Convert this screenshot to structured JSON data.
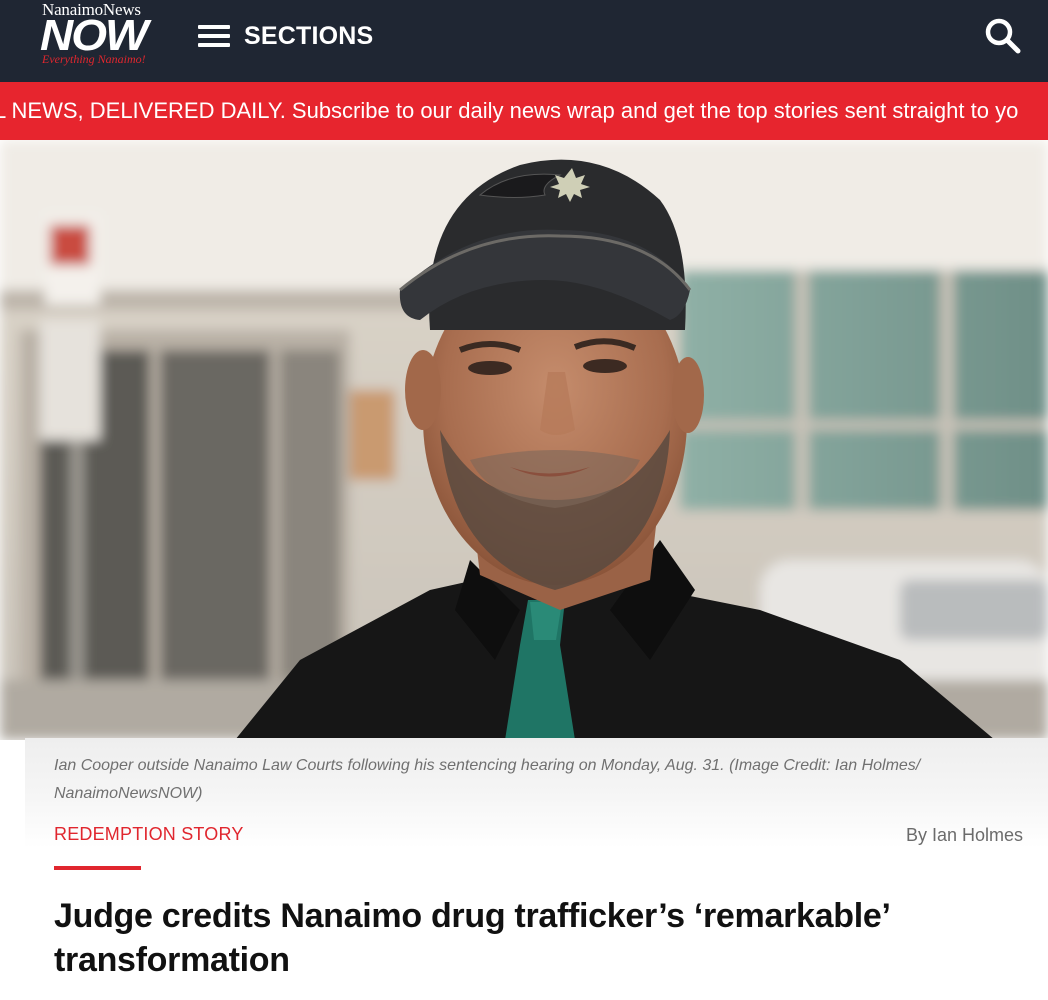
{
  "header": {
    "logo_top": "NanaimoNews",
    "logo_main": "NOW",
    "logo_tagline": "Everything Nanaimo!",
    "sections_label": "SECTIONS",
    "search_icon": "search-icon",
    "menu_icon": "hamburger-icon"
  },
  "ticker": {
    "text": "L NEWS, DELIVERED DAILY. Subscribe to our daily news wrap and get the top stories sent straight to yo"
  },
  "hero": {
    "image": "photo-man-in-cap-outside-courthouse"
  },
  "article": {
    "caption": "Ian Cooper outside Nanaimo Law Courts following his sentencing hearing on Monday, Aug. 31. (Image Credit: Ian Holmes/ NanaimoNewsNOW)",
    "category": "REDEMPTION STORY",
    "byline": "By Ian Holmes",
    "headline": "Judge credits Nanaimo drug trafficker’s ‘remarkable’ transformation"
  },
  "colors": {
    "header_bg": "#1f2633",
    "accent_red": "#e7252e",
    "headline_text": "#111111",
    "caption_text": "#707070"
  }
}
